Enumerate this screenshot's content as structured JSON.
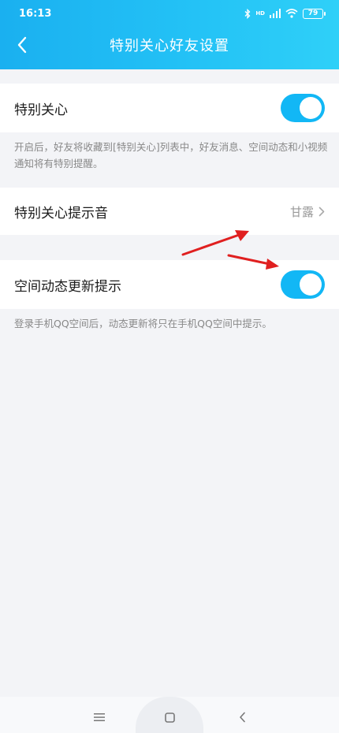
{
  "status_bar": {
    "time": "16:13",
    "network": "HD",
    "battery": "79"
  },
  "header": {
    "title": "特别关心好友设置"
  },
  "special_care": {
    "label": "特别关心",
    "enabled": true,
    "description": "开启后，好友将收藏到[特别关心]列表中，好友消息、空间动态和小视频通知将有特别提醒。"
  },
  "alert_sound": {
    "label": "特别关心提示音",
    "value": "甘露"
  },
  "qzone_update": {
    "label": "空间动态更新提示",
    "enabled": true,
    "description": "登录手机QQ空间后，动态更新将只在手机QQ空间中提示。"
  },
  "colors": {
    "accent": "#12b7f5",
    "annotation_arrow": "#e02020"
  },
  "icons": [
    "back-icon",
    "bluetooth-icon",
    "signal-icon",
    "wifi-icon",
    "battery-icon",
    "chevron-right-icon",
    "menu-icon",
    "home-icon",
    "nav-back-icon"
  ]
}
